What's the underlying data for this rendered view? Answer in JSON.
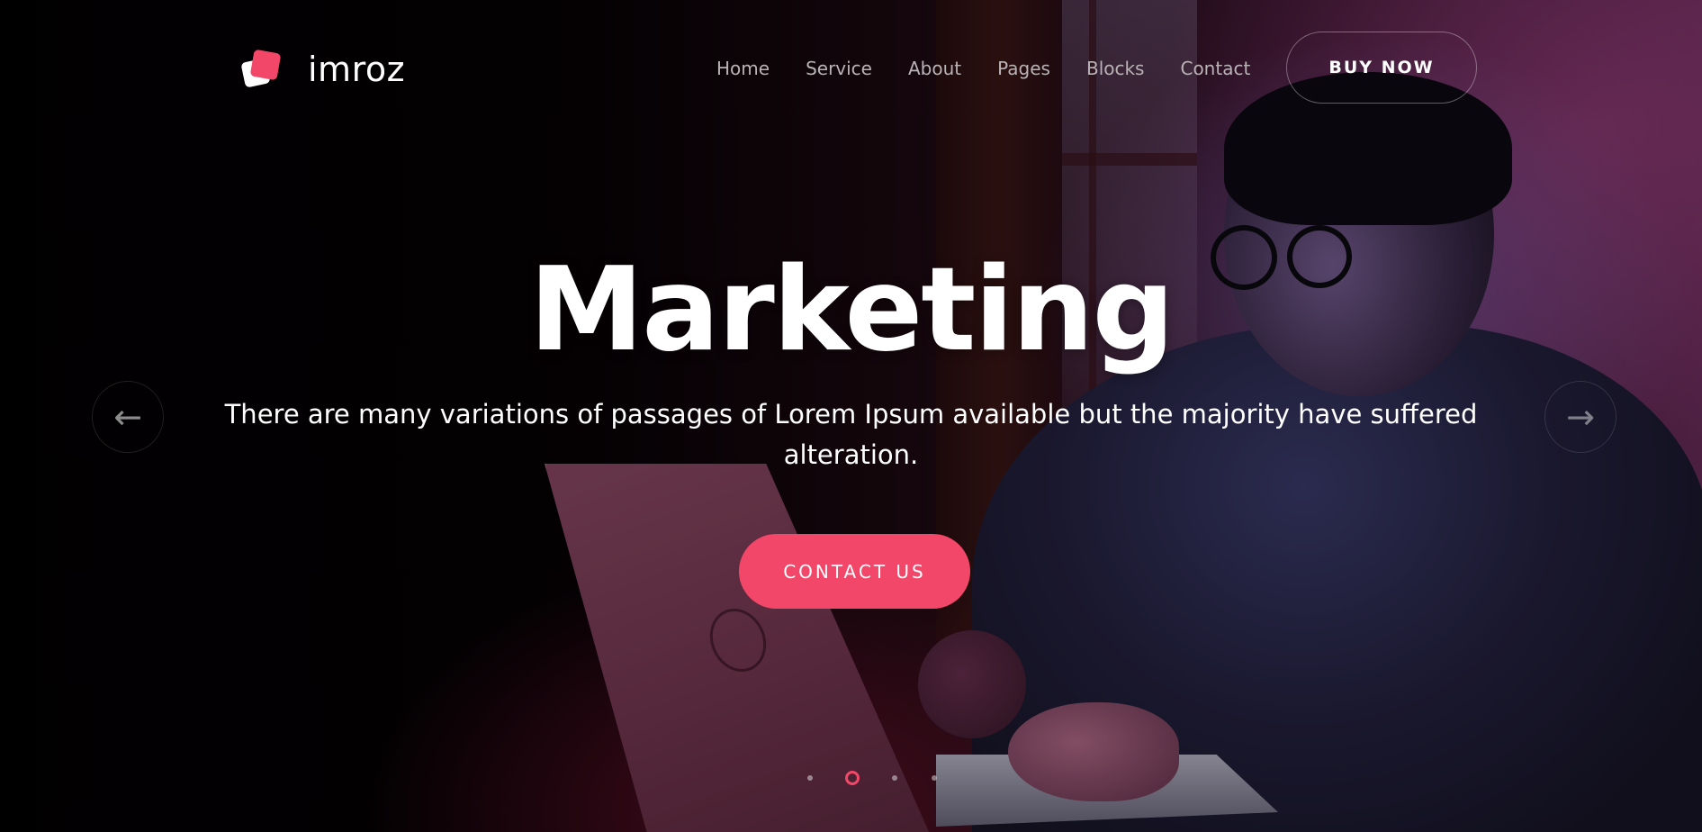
{
  "brand": {
    "name": "imroz",
    "accent_color": "#f24768"
  },
  "nav": {
    "items": [
      "Home",
      "Service",
      "About",
      "Pages",
      "Blocks",
      "Contact"
    ],
    "cta_label": "BUY NOW"
  },
  "hero": {
    "title": "Marketing",
    "subtitle": "There are many variations of passages of Lorem Ipsum available but the majority have suffered alteration.",
    "button_label": "CONTACT US",
    "prev_icon": "arrow-left-icon",
    "next_icon": "arrow-right-icon"
  },
  "slider": {
    "total_slides": 4,
    "active_slide": 2
  }
}
